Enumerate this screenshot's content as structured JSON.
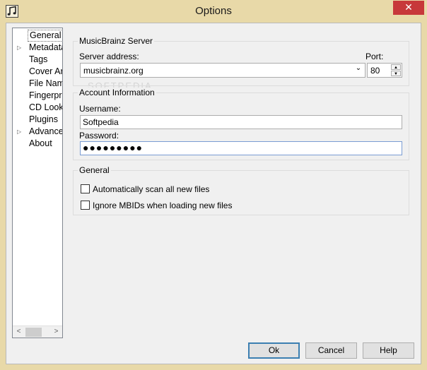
{
  "window": {
    "title": "Options",
    "close_glyph": "✕",
    "icon": "music-note-icon"
  },
  "nav": {
    "items": [
      {
        "label": "General",
        "expandable": false,
        "selected": true
      },
      {
        "label": "Metadata",
        "expandable": true,
        "selected": false
      },
      {
        "label": "Tags",
        "expandable": false,
        "selected": false
      },
      {
        "label": "Cover Art",
        "expandable": false,
        "selected": false
      },
      {
        "label": "File Naming",
        "expandable": false,
        "selected": false
      },
      {
        "label": "Fingerprinting",
        "expandable": false,
        "selected": false
      },
      {
        "label": "CD Lookup",
        "expandable": false,
        "selected": false
      },
      {
        "label": "Plugins",
        "expandable": false,
        "selected": false
      },
      {
        "label": "Advanced",
        "expandable": true,
        "selected": false
      },
      {
        "label": "About",
        "expandable": false,
        "selected": false
      }
    ],
    "expand_glyph": "▷",
    "scroll_left": "<",
    "scroll_right": ">"
  },
  "server": {
    "group_title": "MusicBrainz Server",
    "address_label": "Server address:",
    "address_value": "musicbrainz.org",
    "port_label": "Port:",
    "port_value": "80"
  },
  "account": {
    "group_title": "Account Information",
    "username_label": "Username:",
    "username_value": "Softpedia",
    "password_label": "Password:",
    "password_value": "●●●●●●●●●"
  },
  "general": {
    "group_title": "General",
    "option1_label": "Automatically scan all new files",
    "option1_checked": false,
    "option2_label": "Ignore MBIDs when loading new files",
    "option2_checked": false
  },
  "buttons": {
    "ok": "Ok",
    "cancel": "Cancel",
    "help": "Help"
  },
  "watermark": "SOFTPEDIA",
  "colors": {
    "titlebar": "#e8d9a8",
    "close": "#c7383a",
    "focus_border": "#7a9cd3"
  }
}
